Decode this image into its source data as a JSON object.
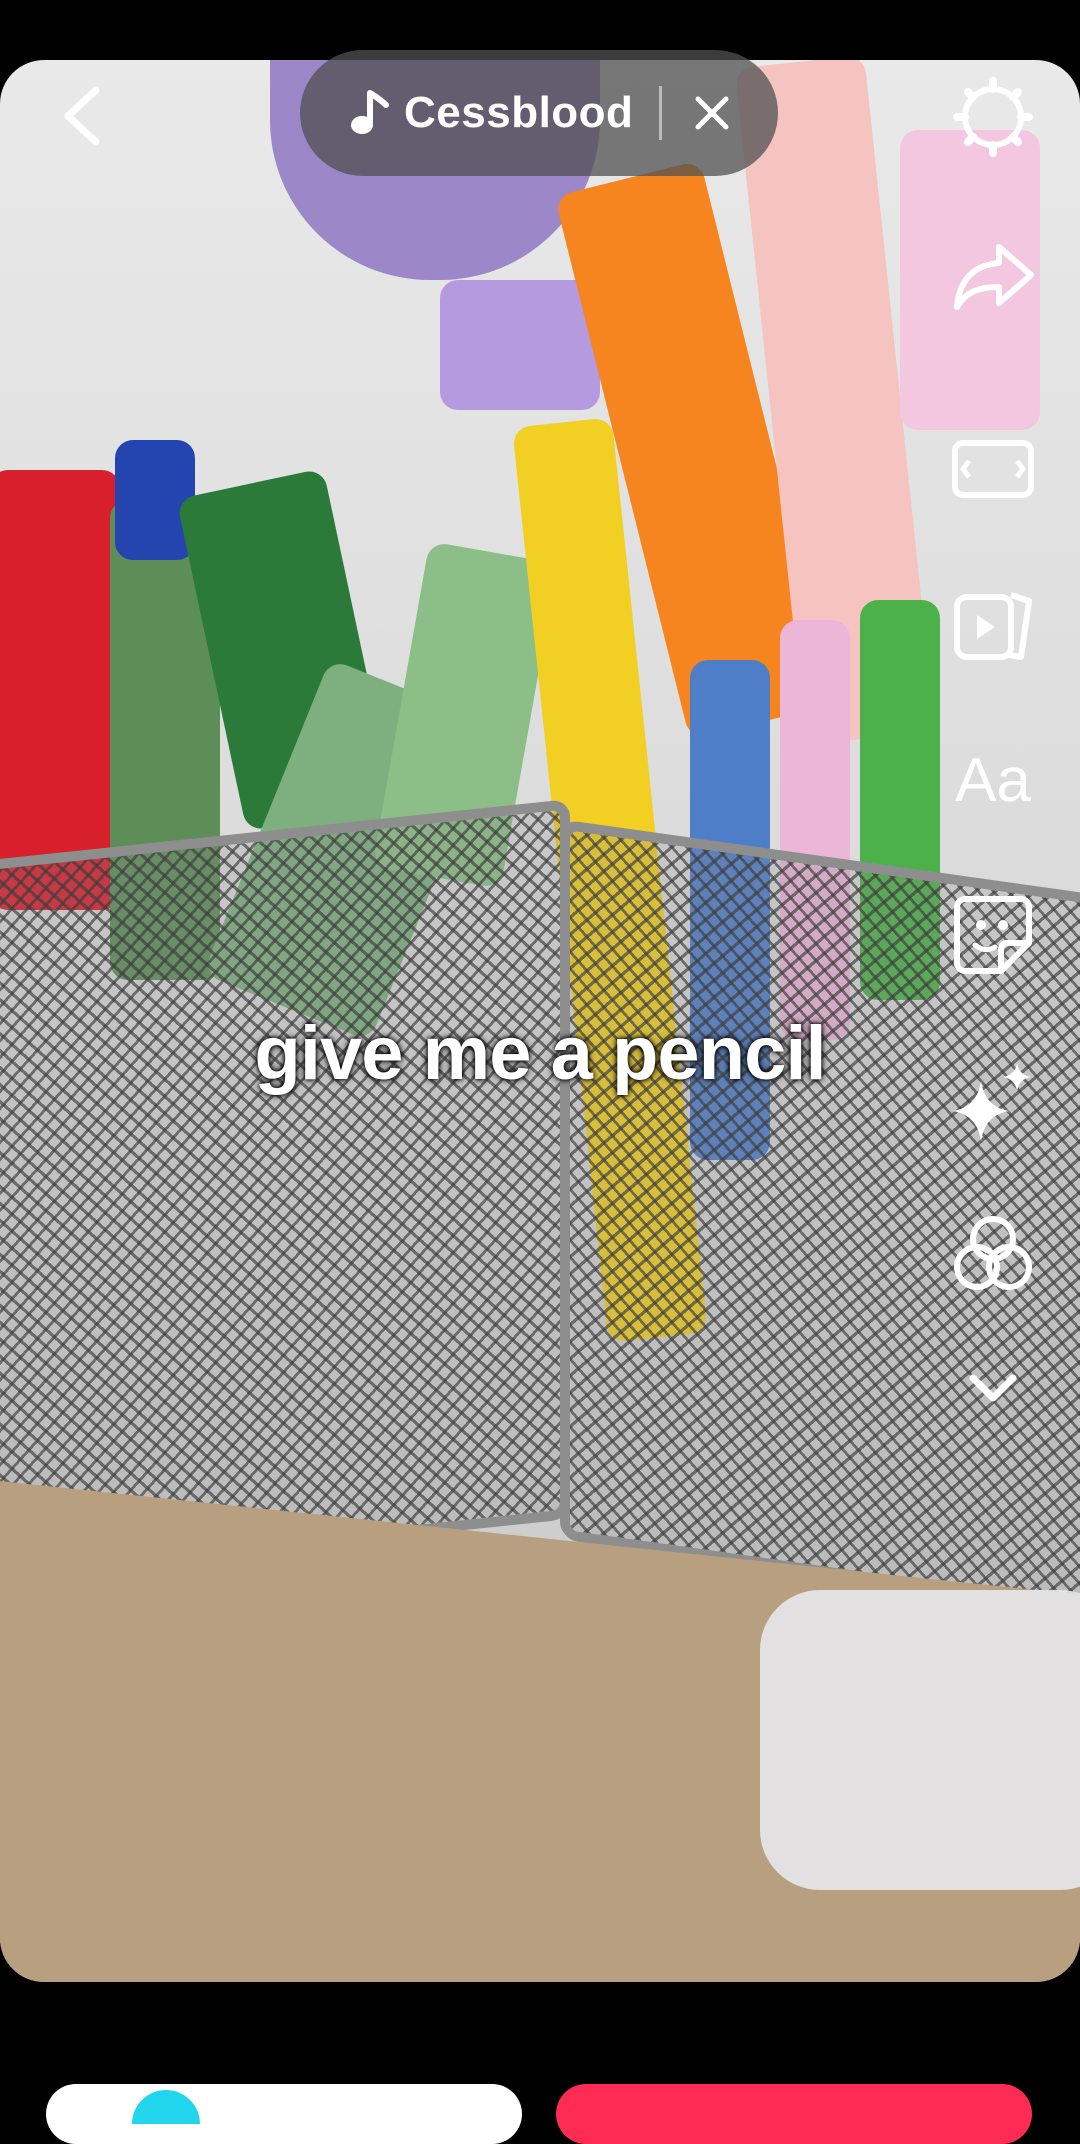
{
  "sound": {
    "name": "Cessblood"
  },
  "caption": "give me a pencil",
  "tools": [
    {
      "name": "settings-icon"
    },
    {
      "name": "share-arrow-icon"
    },
    {
      "name": "aspect-ratio-icon"
    },
    {
      "name": "video-clip-icon"
    },
    {
      "name": "text-tool",
      "label": "Aa"
    },
    {
      "name": "sticker-icon"
    },
    {
      "name": "effects-sparkle-icon"
    },
    {
      "name": "filters-icon"
    },
    {
      "name": "chevron-down-icon"
    }
  ],
  "colors": {
    "accent": "#fe2c55",
    "pill": "#505050",
    "secondary": "#20d5ec"
  }
}
